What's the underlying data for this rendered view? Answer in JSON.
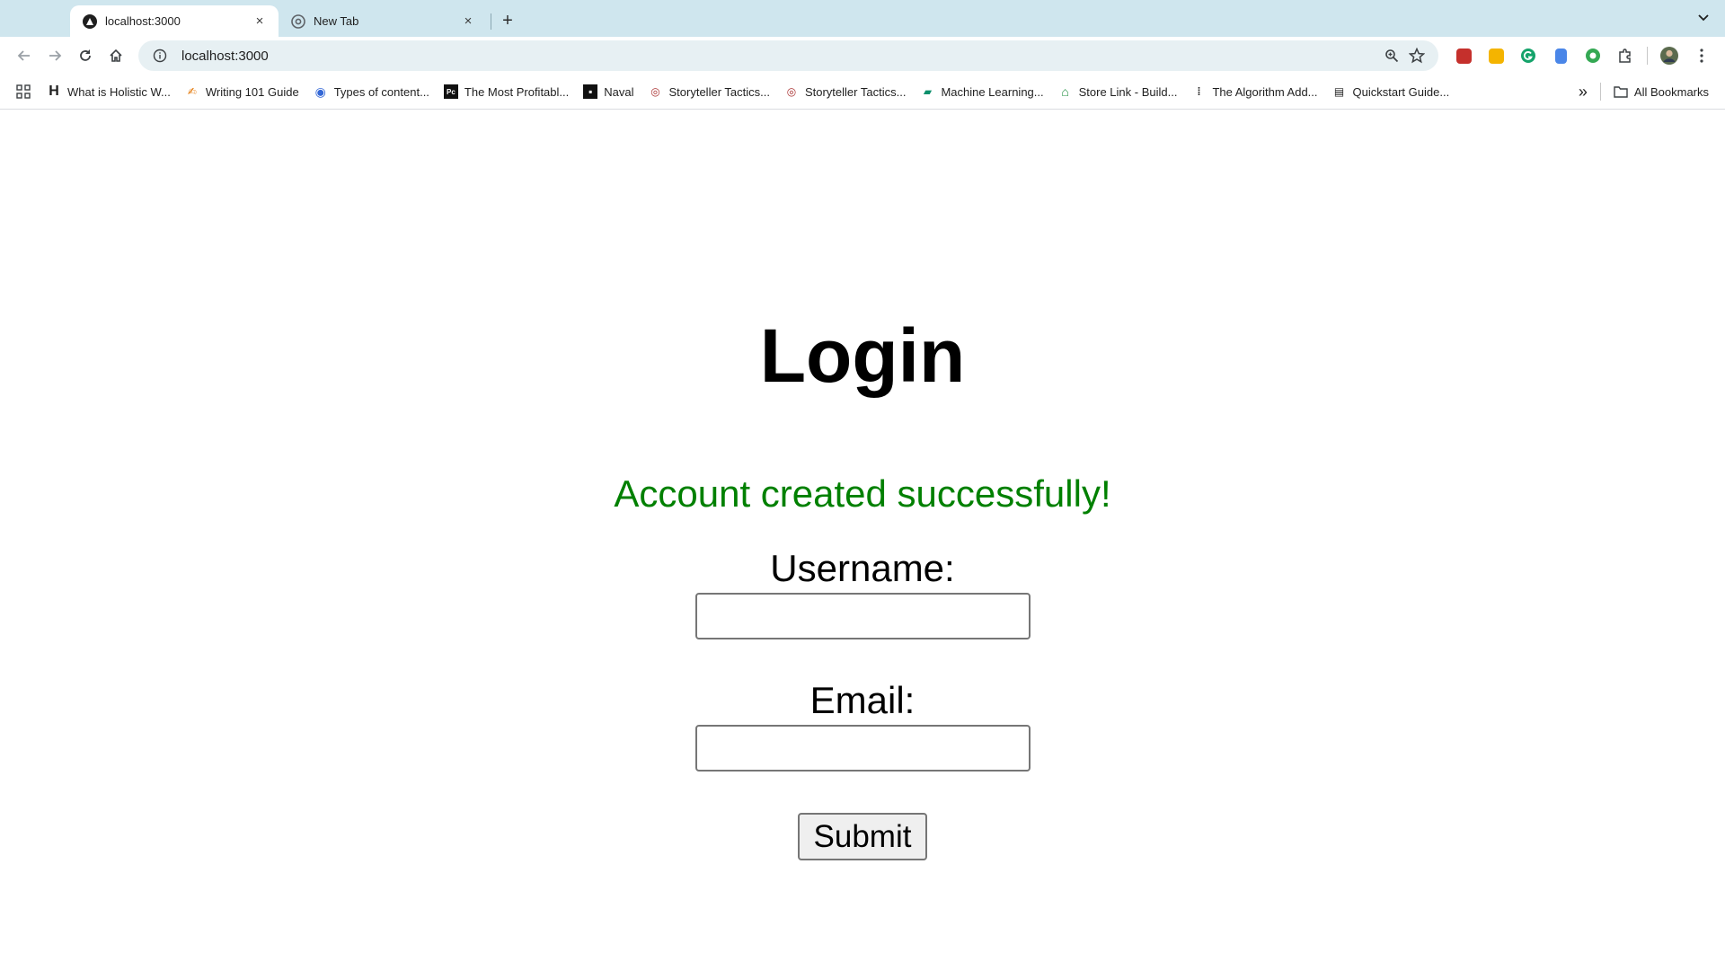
{
  "browser": {
    "tabs": [
      {
        "title": "localhost:3000",
        "active": true
      },
      {
        "title": "New Tab",
        "active": false
      }
    ],
    "new_tab_label": "+",
    "close_label": "×",
    "url": "localhost:3000",
    "bookmarks": [
      {
        "label": "What is Holistic W...",
        "icon": "H"
      },
      {
        "label": "Writing 101 Guide",
        "icon": "✍"
      },
      {
        "label": "Types of content...",
        "icon": "◉"
      },
      {
        "label": "The Most Profitabl...",
        "icon": "Pc"
      },
      {
        "label": "Naval",
        "icon": "▪"
      },
      {
        "label": "Storyteller Tactics...",
        "icon": "◎"
      },
      {
        "label": "Storyteller Tactics...",
        "icon": "◎"
      },
      {
        "label": "Machine Learning...",
        "icon": "▰"
      },
      {
        "label": "Store Link - Build...",
        "icon": "⌂"
      },
      {
        "label": "The Algorithm Add...",
        "icon": "⁞"
      },
      {
        "label": "Quickstart Guide...",
        "icon": "▤"
      }
    ],
    "bookmarks_overflow": "»",
    "all_bookmarks_label": "All Bookmarks",
    "colors": {
      "tabstrip": "#cfe6ee",
      "omnibox": "#e7f0f3"
    }
  },
  "page": {
    "title": "Login",
    "success_message": "Account created successfully!",
    "username_label": "Username:",
    "username_value": "",
    "email_label": "Email:",
    "email_value": "",
    "submit_label": "Submit",
    "colors": {
      "success": "#008000",
      "text": "#000000"
    }
  }
}
